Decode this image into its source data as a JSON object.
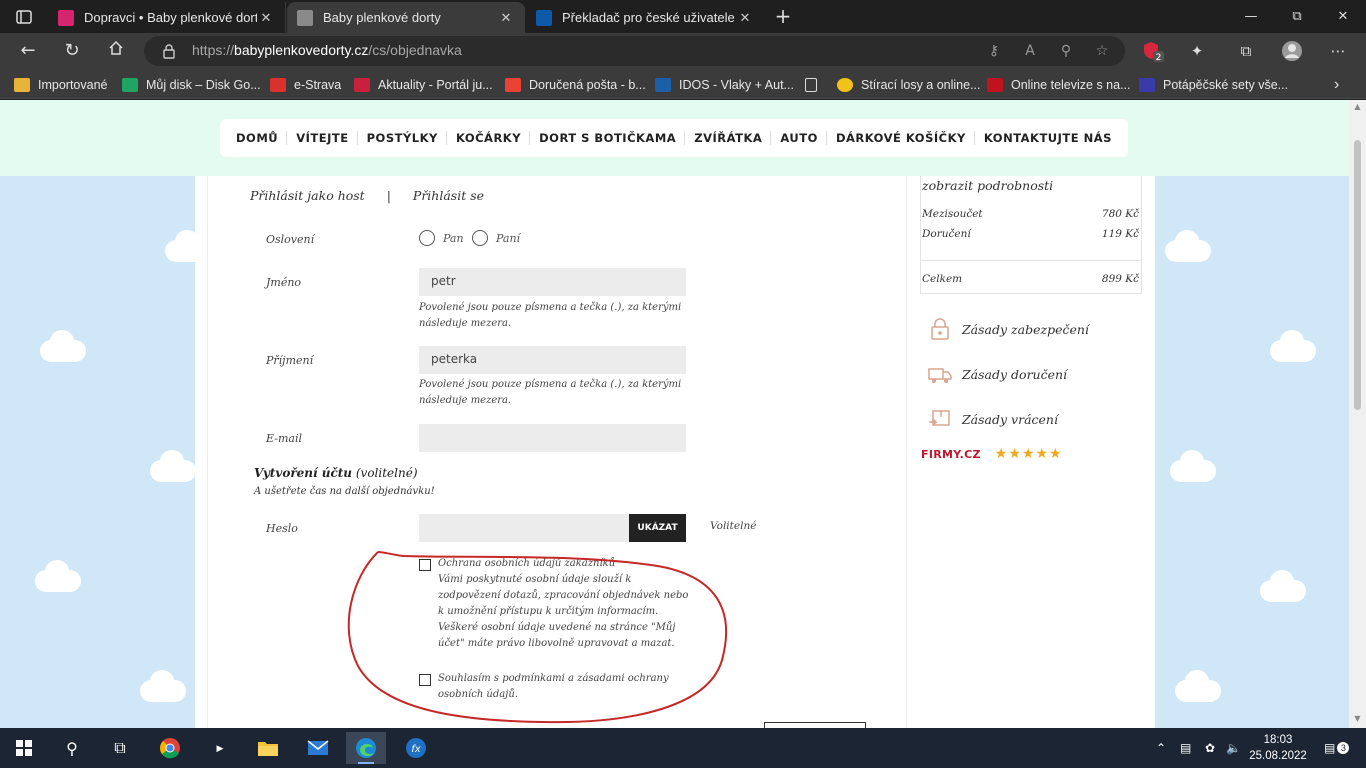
{
  "browser": {
    "tabs": [
      {
        "title": "Dopravci • Baby plenkové dorty",
        "favicon_color": "#d6246e"
      },
      {
        "title": "Baby plenkové dorty",
        "favicon_color": "#8a8a8a"
      },
      {
        "title": "Překladač pro české uživatele | Č",
        "favicon_color": "#0f5aa8"
      }
    ],
    "url_prefix": "https://",
    "url_host": "babyplenkovedorty.cz",
    "url_path": "/cs/objednavka",
    "extension_badge": "2",
    "bookmarks": [
      {
        "label": "Importované",
        "color": "#e8b33a"
      },
      {
        "label": "Můj disk – Disk Go...",
        "color": "#1fa463"
      },
      {
        "label": "e-Strava",
        "color": "#d9322c"
      },
      {
        "label": "Aktuality - Portál ju...",
        "color": "#c9213d"
      },
      {
        "label": "Doručená pošta - b...",
        "color": "#ea4335"
      },
      {
        "label": "IDOS - Vlaky + Aut...",
        "color": "#1b5fa8"
      },
      {
        "label": "Stírací losy a online...",
        "color": "#f2c21a"
      },
      {
        "label": "Online televize s na...",
        "color": "#c1121f"
      },
      {
        "label": "Potápěčské sety vše...",
        "color": "#3a3aa8"
      }
    ]
  },
  "site": {
    "nav": [
      "DOMŮ",
      "VÍTEJTE",
      "POSTÝLKY",
      "KOČÁRKY",
      "DORT S BOTIČKAMA",
      "ZVÍŘÁTKA",
      "AUTO",
      "DÁRKOVÉ KOŠÍČKY",
      "KONTAKTUJTE NÁS"
    ],
    "form": {
      "login_guest": "Přihlásit jako host",
      "login_sep": "|",
      "login_signin": "Přihlásit se",
      "salutation_label": "Oslovení",
      "salutation_options": [
        "Pan",
        "Paní"
      ],
      "first_name_label": "Jméno",
      "first_name_value": "petr",
      "first_name_hint": "Povolené jsou pouze písmena a tečka (.), za kterými následuje mezera.",
      "last_name_label": "Příjmení",
      "last_name_value": "peterka",
      "last_name_hint": "Povolené jsou pouze písmena a tečka (.), za kterými následuje mezera.",
      "email_label": "E-mail",
      "email_value": "",
      "account_title_bold": "Vytvoření účtu",
      "account_title_rest": "(volitelné)",
      "account_subtitle": "A ušetřete čas na další objednávku!",
      "password_label": "Heslo",
      "show_button": "UKÁZAT",
      "optional_label": "Volitelné",
      "privacy_title": "Ochrana osobních údajů zákazníků",
      "privacy_text": "Vámi poskytnuté osobní údaje slouží k zodpovězení dotazů, zpracování objednávek nebo k umožnění přístupu k určitým informacím. Veškeré osobní údaje uvedené na stránce \"Můj účet\" máte právo libovolně upravovat a mazat.",
      "terms_text": "Souhlasím s podmínkami a zásadami ochrany osobních údajů."
    },
    "summary": {
      "details_link": "zobrazit podrobnosti",
      "subtotal_label": "Mezisoučet",
      "subtotal_value": "780 Kč",
      "shipping_label": "Doručení",
      "shipping_value": "119 Kč",
      "total_label": "Celkem",
      "total_value": "899 Kč"
    },
    "policies": [
      "Zásady zabezpečení",
      "Zásady doručení",
      "Zásady vrácení"
    ],
    "firmy_logo": "FIRMY.CZ",
    "rating_stars": 5
  },
  "taskbar": {
    "time": "18:03",
    "date": "25.08.2022",
    "notifications": "3"
  }
}
